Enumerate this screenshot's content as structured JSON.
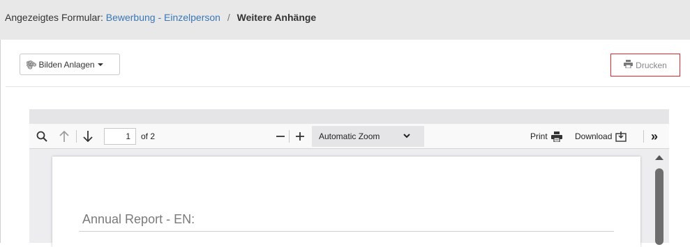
{
  "breadcrumb": {
    "prefix": "Angezeigtes Formular:",
    "link": "Bewerbung - Einzelperson",
    "separator": "/",
    "current": "Weitere Anhänge"
  },
  "actions": {
    "attach_label": "Bilden Anlagen",
    "print_label": "Drucken"
  },
  "pdf_viewer": {
    "page_current": "1",
    "page_total_label": "of 2",
    "zoom_value": "Automatic Zoom",
    "print_label": "Print",
    "download_label": "Download",
    "more_tools": "»"
  },
  "document": {
    "heading": "Annual Report - EN:"
  },
  "colors": {
    "link": "#3a77b6",
    "print_highlight": "#e0262f",
    "header_bg": "#e8e8e8"
  }
}
